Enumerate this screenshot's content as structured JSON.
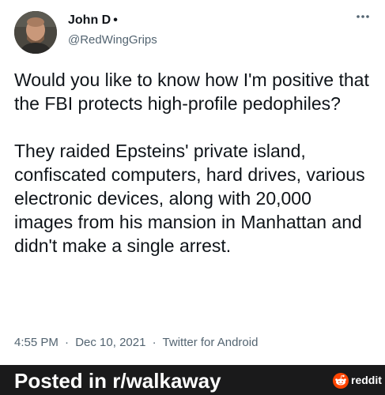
{
  "tweet": {
    "display_name": "John D",
    "name_separator": "•",
    "handle": "@RedWingGrips",
    "paragraphs": [
      "Would you like to know how I'm positive that the FBI protects high-profile pedophiles?",
      "They raided Epsteins' private island, confiscated computers, hard drives, various electronic devices, along with 20,000 images from his mansion in Manhattan and didn't make a single arrest."
    ],
    "time": "4:55 PM",
    "date": "Dec 10, 2021",
    "source": "Twitter for Android",
    "meta_separator": "·",
    "more_icon": "more-horizontal-icon"
  },
  "footer": {
    "posted_in": "Posted in r/walkaway",
    "brand": "reddit",
    "logo_icon": "reddit-alien-icon"
  },
  "colors": {
    "text_primary": "#0f1419",
    "text_secondary": "#536471",
    "footer_bg": "#1a1a1b",
    "reddit_orange": "#ff4500"
  }
}
